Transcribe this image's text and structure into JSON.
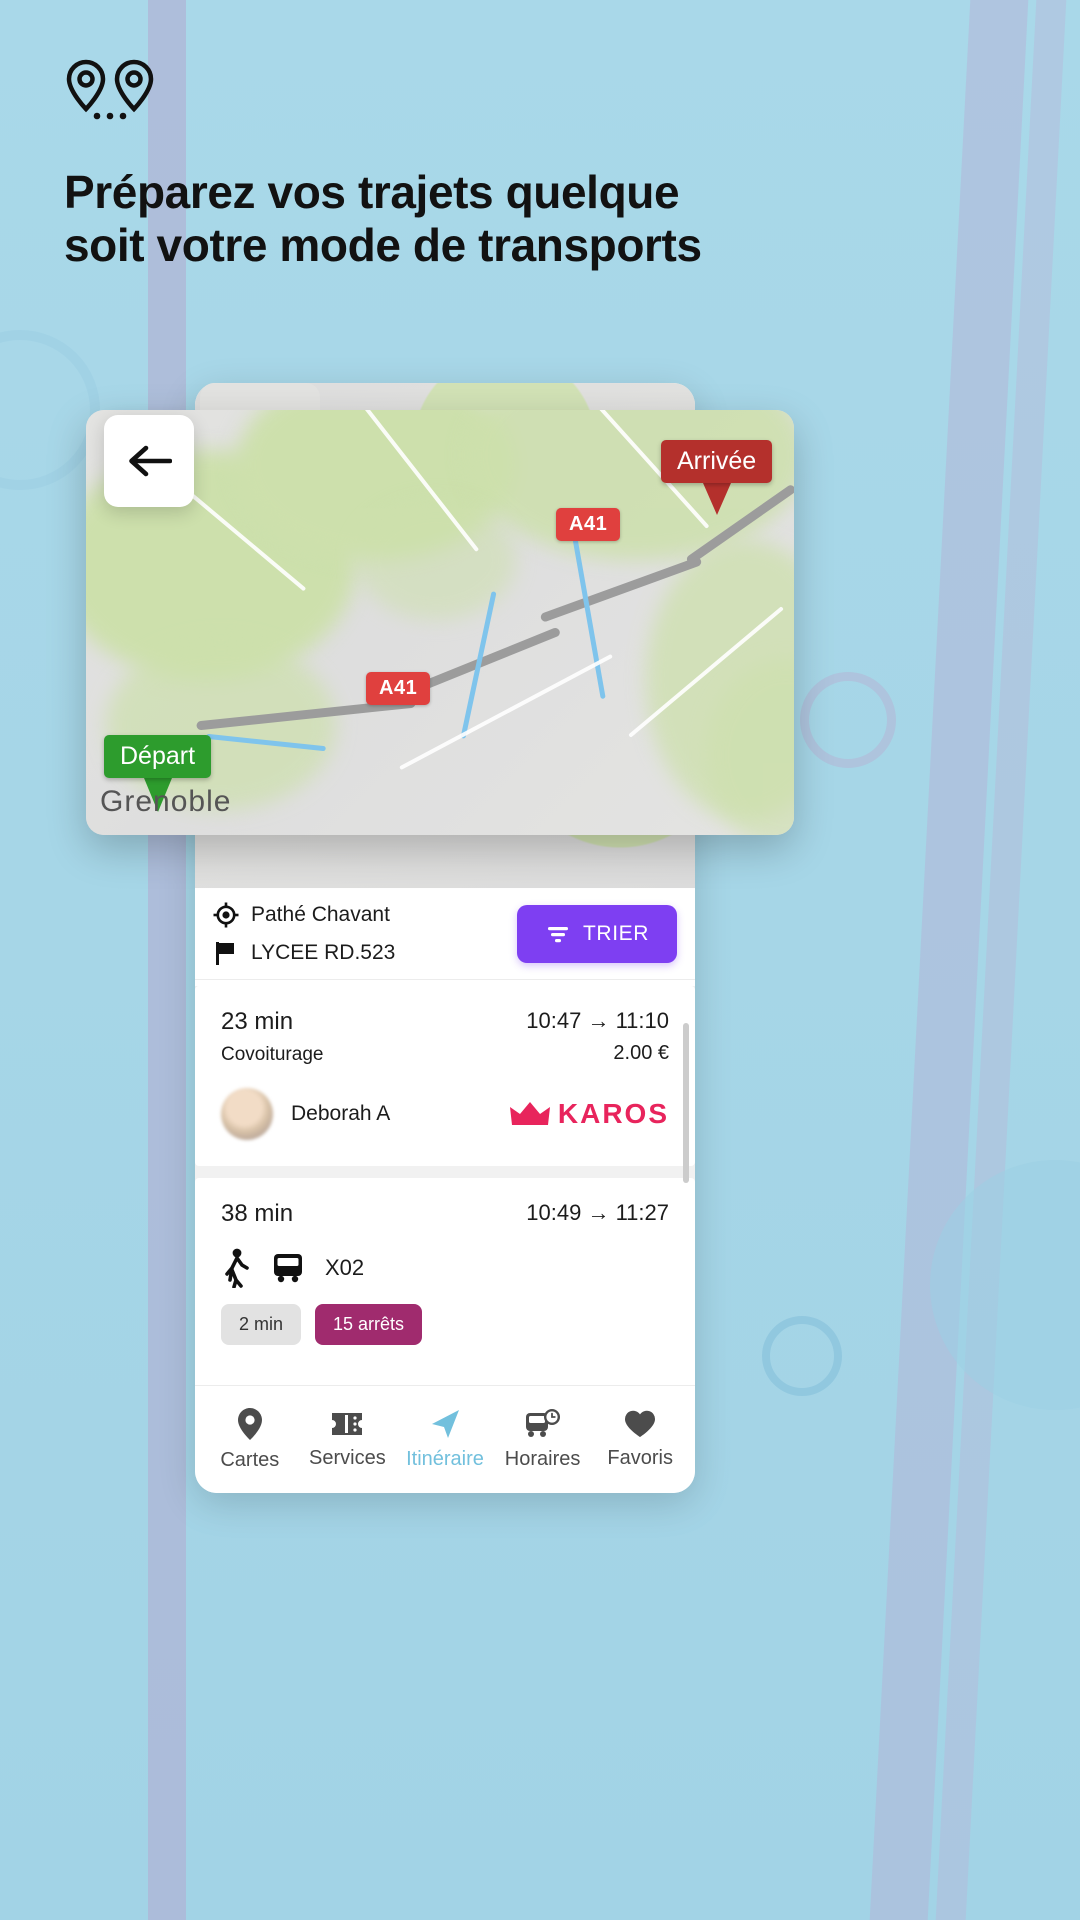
{
  "promo": {
    "headline_line1": "Préparez vos trajets quelque",
    "headline_line2": "soit votre mode de transports",
    "pins_icon": "double-map-pin-icon",
    "background_color": "#a8d7e8"
  },
  "map_card": {
    "back_icon": "arrow-left-icon",
    "markers": [
      {
        "id": "arrivee",
        "label": "Arrivée",
        "color": "#b4302c",
        "type": "destination"
      },
      {
        "id": "depart",
        "label": "Départ",
        "color": "#2d9c2d",
        "type": "origin"
      }
    ],
    "city_label": "Grenoble",
    "highway_badges": [
      "A41",
      "A41"
    ]
  },
  "search_header": {
    "origin_icon": "crosshair-icon",
    "origin": "Pathé Chavant",
    "destination_icon": "flag-icon",
    "destination": "LYCEE RD.523",
    "sort_button": {
      "label": "TRIER",
      "icon": "filter-icon",
      "color": "#7e3ff2"
    }
  },
  "results": [
    {
      "duration": "23 min",
      "mode": "Covoiturage",
      "depart_time": "10:47",
      "arrow": "→",
      "arrive_time": "11:10",
      "price": "2.00 €",
      "driver_name": "Deborah A",
      "provider": "KAROS",
      "provider_icon": "crown-icon",
      "provider_color": "#e8245c",
      "avatar": "driver-avatar"
    },
    {
      "duration": "38 min",
      "mode": "",
      "depart_time": "10:49",
      "arrow": "→",
      "arrive_time": "11:27",
      "price": "",
      "walk_icon": "walking-person-icon",
      "bus_icon": "bus-icon",
      "bus_line": "X02",
      "chips": [
        {
          "label": "2 min",
          "kind": "walk"
        },
        {
          "label": "15 arrêts",
          "kind": "bus"
        }
      ]
    }
  ],
  "bottom_nav": {
    "active_color": "#72c0dd",
    "items": [
      {
        "label": "Cartes",
        "icon": "map-pin-icon",
        "active": false
      },
      {
        "label": "Services",
        "icon": "ticket-icon",
        "active": false
      },
      {
        "label": "Itinéraire",
        "icon": "navigate-icon",
        "active": true
      },
      {
        "label": "Horaires",
        "icon": "bus-clock-icon",
        "active": false
      },
      {
        "label": "Favoris",
        "icon": "heart-icon",
        "active": false
      }
    ]
  }
}
